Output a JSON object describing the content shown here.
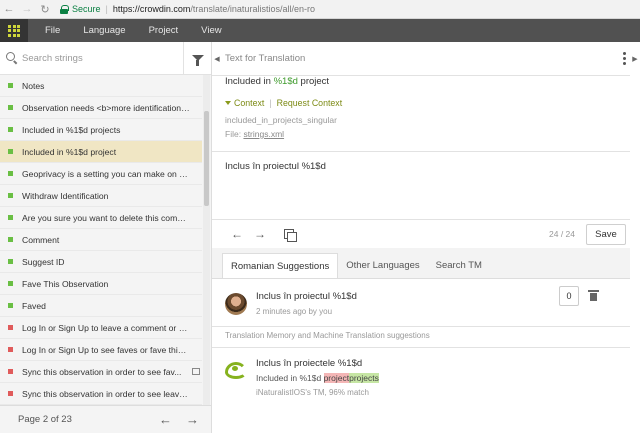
{
  "browser": {
    "secure_label": "Secure",
    "url_host": "https://crowdin.com",
    "url_path": "/translate/inaturalistios/all/en-ro"
  },
  "menu": [
    "File",
    "Language",
    "Project",
    "View"
  ],
  "sidebar": {
    "search_placeholder": "Search strings",
    "items": [
      {
        "text": "Notes",
        "status": "green"
      },
      {
        "text": "Observation needs <b>more identifications...",
        "status": "green"
      },
      {
        "text": "Included in %1$d projects",
        "status": "green"
      },
      {
        "text": "Included in %1$d project",
        "status": "green",
        "selected": true
      },
      {
        "text": "Geoprivacy is a setting you can make on yo...",
        "status": "green"
      },
      {
        "text": "Withdraw Identification",
        "status": "green"
      },
      {
        "text": "Are you sure you want to delete this comm...",
        "status": "green"
      },
      {
        "text": "Comment",
        "status": "green"
      },
      {
        "text": "Suggest ID",
        "status": "green"
      },
      {
        "text": "Fave This Observation",
        "status": "green"
      },
      {
        "text": "Faved",
        "status": "green"
      },
      {
        "text": "Log In or Sign Up to leave a comment or su...",
        "status": "red"
      },
      {
        "text": "Log In or Sign Up to see faves or fave this o...",
        "status": "red"
      },
      {
        "text": "Sync this observation in order to see fav...",
        "status": "red",
        "comment_icon": true
      },
      {
        "text": "Sync this observation in order to see leave ...",
        "status": "red"
      }
    ],
    "pager": "Page 2 of 23"
  },
  "source": {
    "section_title": "Text for Translation",
    "text_before": "Included in ",
    "placeholder": "%1$d",
    "text_after": " project",
    "context_label": "Context",
    "request_context_label": "Request Context",
    "key": "included_in_projects_singular",
    "file_label": "File:",
    "file_name": "strings.xml"
  },
  "translation": {
    "text": "Inclus în proiectul %1$d",
    "counter": "24 / 24",
    "save_label": "Save"
  },
  "tabs": [
    "Romanian Suggestions",
    "Other Languages",
    "Search TM"
  ],
  "suggestion": {
    "text": "Inclus în proiectul %1$d",
    "meta": "2 minutes ago by you",
    "votes": "0"
  },
  "tm": {
    "caption": "Translation Memory and Machine Translation suggestions",
    "text": "Inclus în proiectele %1$d",
    "diff_prefix": "Included in %1$d ",
    "diff_deleted": "project",
    "diff_inserted": "projects",
    "source": "iNaturalistIOS's TM, 96% match"
  },
  "colors": {
    "accent_green": "#6abf44",
    "untranslated_red": "#e05b5b",
    "selected_row": "#f0e6c4",
    "menubar": "#515151"
  }
}
